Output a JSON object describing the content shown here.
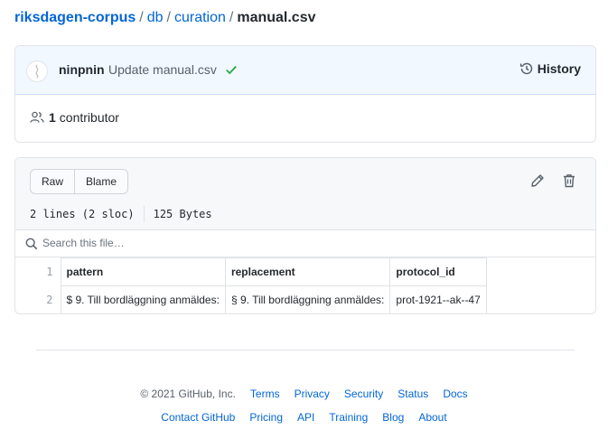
{
  "breadcrumb": {
    "repo": "riksdagen-corpus",
    "sep": "/",
    "folder1": "db",
    "folder2": "curation",
    "file": "manual.csv"
  },
  "commit": {
    "author": "ninpnin",
    "message": "Update manual.csv",
    "history_label": "History",
    "contributor_count": "1",
    "contributor_label": "contributor"
  },
  "file": {
    "raw_label": "Raw",
    "blame_label": "Blame",
    "lines": "2 lines (2 sloc)",
    "size": "125 Bytes",
    "search_placeholder": "Search this file…"
  },
  "csv": {
    "headers": [
      "pattern",
      "replacement",
      "protocol_id"
    ],
    "rows": [
      [
        "$ 9. Till bordläggning anmäldes:",
        "§ 9. Till bordläggning anmäldes:",
        "prot-1921--ak--47"
      ]
    ],
    "line_numbers": [
      "1",
      "2"
    ]
  },
  "footer": {
    "copyright": "© 2021 GitHub, Inc.",
    "links_row1": [
      "Terms",
      "Privacy",
      "Security",
      "Status",
      "Docs"
    ],
    "links_row2": [
      "Contact GitHub",
      "Pricing",
      "API",
      "Training",
      "Blog",
      "About"
    ]
  },
  "colors": {
    "link": "#0366d6",
    "success": "#28a745",
    "commit_bg": "#f1f8ff"
  }
}
